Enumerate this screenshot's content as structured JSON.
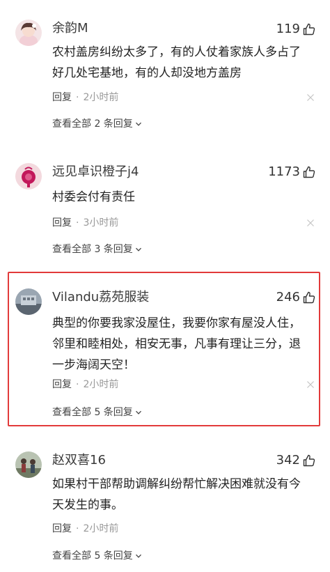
{
  "comments": [
    {
      "username": "余韵M",
      "likes": "119",
      "lines": [
        "农村盖房纠纷太多了，有的人仗着家族人多占了",
        "好几处宅基地，有的人却没地方盖房"
      ],
      "reply_label": "回复",
      "dot": "·",
      "time": "2小时前",
      "view_all": "查看全部 2 条回复"
    },
    {
      "username": "远见卓识橙子j4",
      "likes": "1173",
      "lines": [
        "村委会付有责任"
      ],
      "reply_label": "回复",
      "dot": "·",
      "time": "3小时前",
      "view_all": "查看全部 3 条回复"
    },
    {
      "username": "Vilandu荔苑服装",
      "likes": "246",
      "lines": [
        "典型的你要我家没屋住，我要你家有屋没人住，",
        "邻里和睦相处，相安无事，凡事有理让三分，退",
        "一步海阔天空！"
      ],
      "reply_label": "回复",
      "dot": "·",
      "time": "2小时前",
      "view_all": "查看全部 5 条回复"
    },
    {
      "username": "赵双喜16",
      "likes": "342",
      "lines": [
        "如果村干部帮助调解纠纷帮忙解决困难就没有今",
        "天发生的事。"
      ],
      "reply_label": "回复",
      "dot": "·",
      "time": "2小时前",
      "view_all": "查看全部 5 条回复"
    }
  ],
  "colors": {
    "highlight_border": "#e23a3a",
    "meta_gray": "#999999",
    "text": "#222222"
  },
  "icons": {
    "like": "thumbs-up-icon",
    "close": "close-icon",
    "chevron": "chevron-down-icon"
  }
}
